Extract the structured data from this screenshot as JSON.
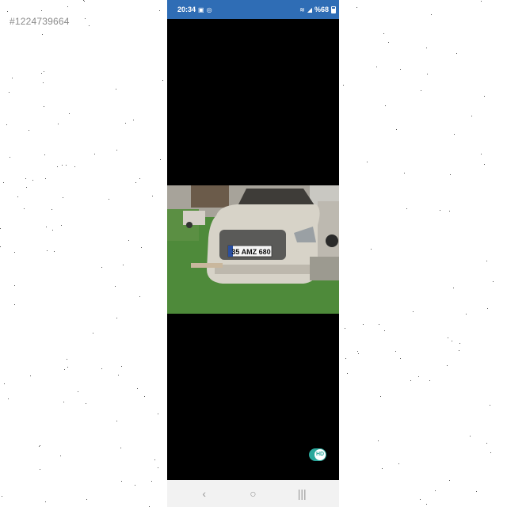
{
  "listing": {
    "id_text": "#1224739664"
  },
  "status_bar": {
    "time": "20:34",
    "left_icons": [
      "gallery-icon",
      "whatsapp-icon"
    ],
    "right_icons": [
      "wifi-icon",
      "signal-icon"
    ],
    "battery_text": "%68"
  },
  "viewer": {
    "photo": {
      "plate_text": "35 AMZ 680",
      "car_color": "#d7d3c8",
      "grass_color": "#4e8a3a"
    },
    "hd_toggle_label": "HD"
  },
  "nav_bar": {
    "back_glyph": "‹",
    "home_glyph": "○",
    "recents_glyph": "|||"
  },
  "colors": {
    "status_bar": "#2f6db5",
    "toggle_accent": "#2aa79b"
  }
}
